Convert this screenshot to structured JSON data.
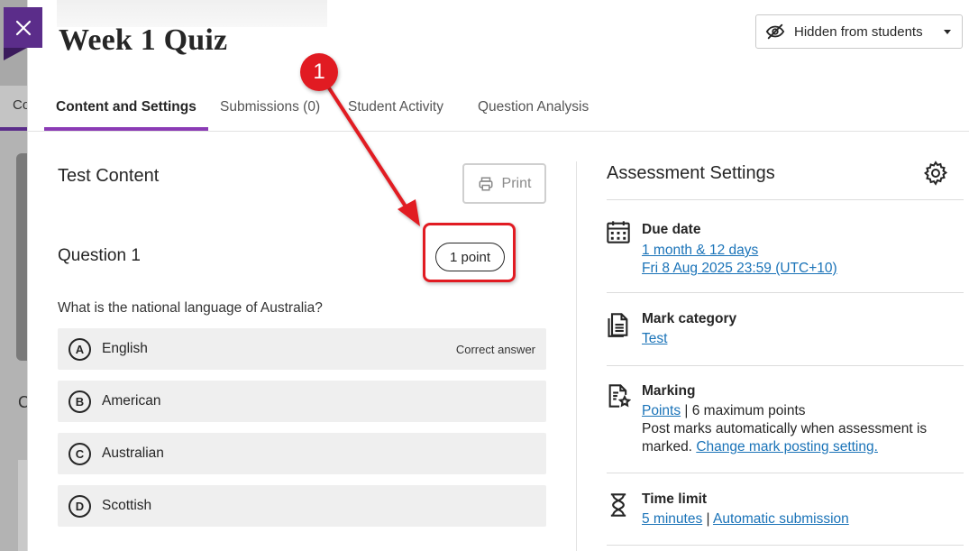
{
  "header": {
    "title": "Week 1 Quiz",
    "visibility_label": "Hidden from students"
  },
  "tabs": [
    {
      "label": "Content and Settings",
      "active": true
    },
    {
      "label": "Submissions (0)",
      "active": false
    },
    {
      "label": "Student Activity",
      "active": false
    },
    {
      "label": "Question Analysis",
      "active": false
    }
  ],
  "backdrop": {
    "tab_fragment": "Co",
    "heading_fragment": "C"
  },
  "content": {
    "section_title": "Test Content",
    "print_label": "Print",
    "question": {
      "title": "Question 1",
      "points": "1 point",
      "text": "What is the national language of Australia?",
      "answers": [
        {
          "letter": "A",
          "text": "English",
          "note": "Correct answer"
        },
        {
          "letter": "B",
          "text": "American",
          "note": ""
        },
        {
          "letter": "C",
          "text": "Australian",
          "note": ""
        },
        {
          "letter": "D",
          "text": "Scottish",
          "note": ""
        }
      ]
    }
  },
  "settings": {
    "title": "Assessment Settings",
    "due_date": {
      "label": "Due date",
      "relative": "1 month & 12 days",
      "absolute": "Fri 8 Aug 2025 23:59 (UTC+10)"
    },
    "mark_category": {
      "label": "Mark category",
      "value": "Test"
    },
    "marking": {
      "label": "Marking",
      "scheme_link": "Points",
      "separator": "|",
      "max_points": "6 maximum points",
      "posting_text_1": "Post marks automatically when assessment is",
      "posting_text_2": "marked.",
      "posting_link": "Change mark posting setting."
    },
    "time_limit": {
      "label": "Time limit",
      "duration_link": "5 minutes",
      "separator": "|",
      "submission_link": "Automatic submission"
    }
  },
  "annotation": {
    "step": "1",
    "color": "#e11b22"
  },
  "colors": {
    "accent": "#5b2d8a",
    "tab_underline": "#8b3bb5",
    "link": "#1a73b8",
    "highlight": "#e11b22"
  }
}
